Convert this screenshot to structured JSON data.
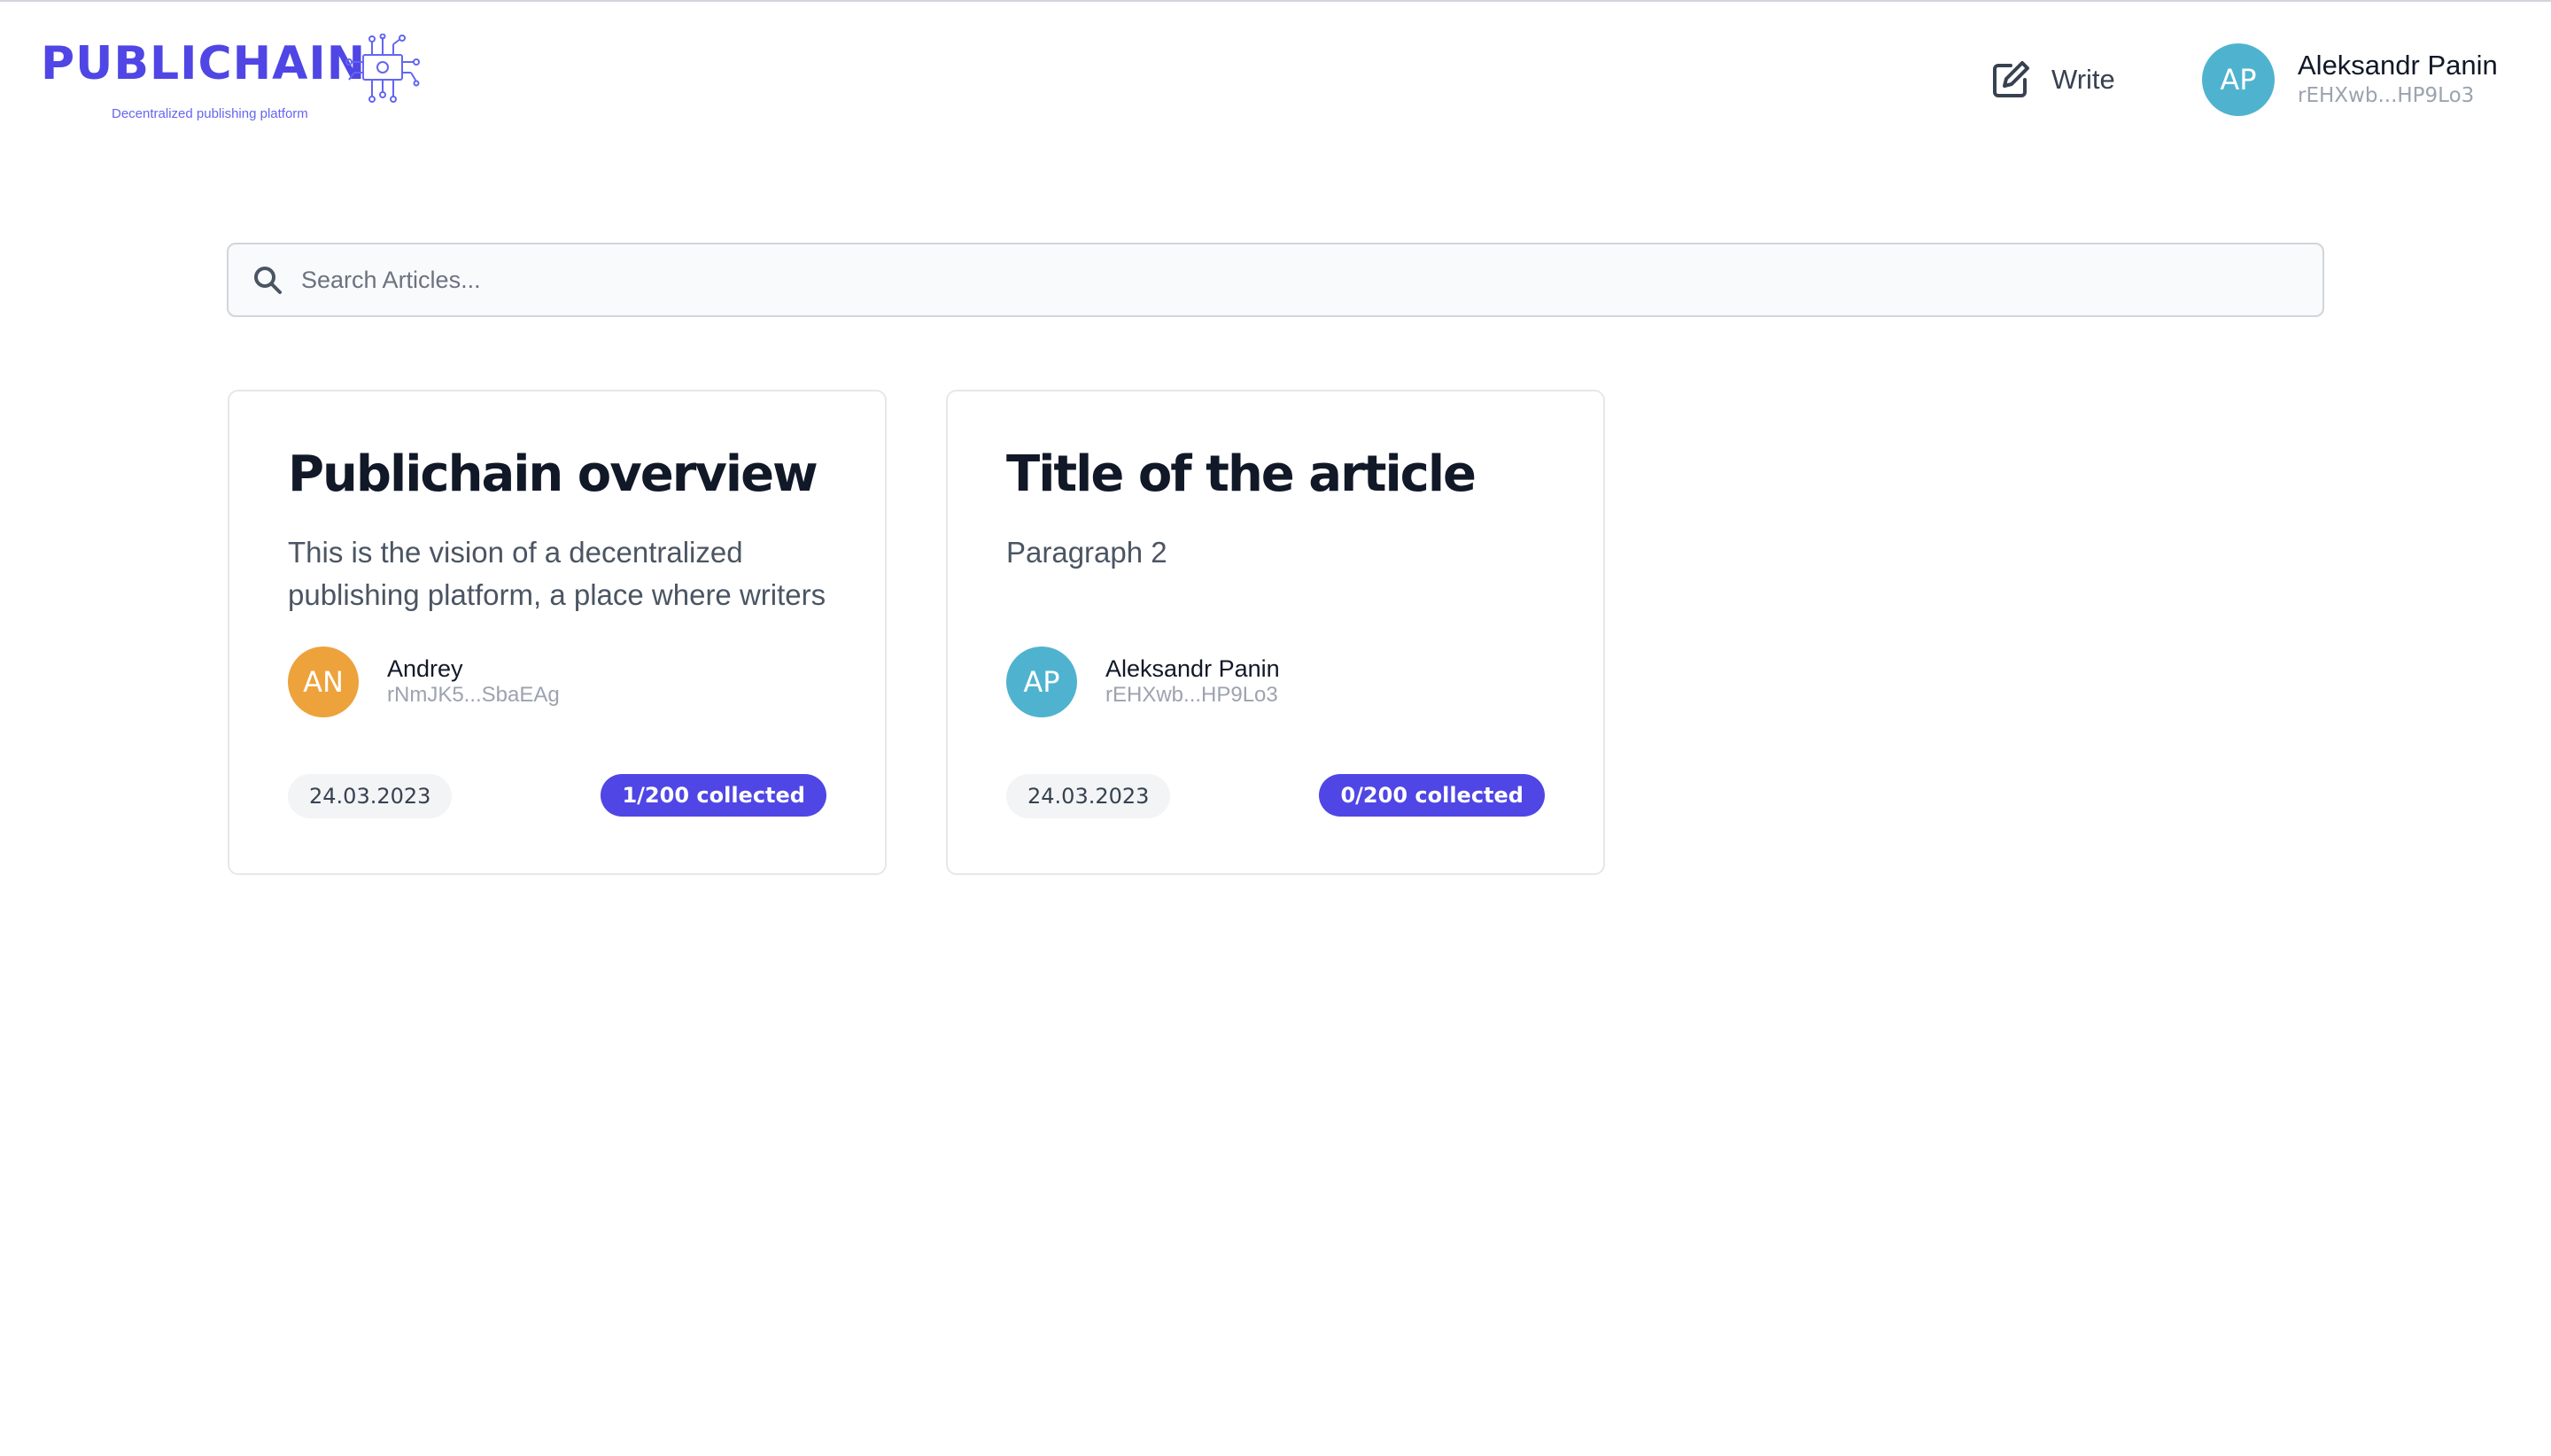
{
  "brand": {
    "name": "PUBLICHAIN",
    "tagline": "Decentralized publishing platform",
    "color": "#4f46e5",
    "logo_icon": "circuit-icon"
  },
  "header": {
    "write_label": "Write",
    "write_icon": "edit-icon",
    "user": {
      "initials": "AP",
      "name": "Aleksandr Panin",
      "address": "rEHXwb...HP9Lo3",
      "avatar_color": "#4fb3cf"
    }
  },
  "search": {
    "placeholder": "Search Articles...",
    "value": "",
    "icon": "search-icon"
  },
  "articles": [
    {
      "title": "Publichain overview",
      "excerpt": "This is the vision of a decentralized publishing platform, a place where writers",
      "author": {
        "initials": "AN",
        "name": "Andrey",
        "address": "rNmJK5...SbaEAg",
        "avatar_color": "#eda23b"
      },
      "date": "24.03.2023",
      "collected": "1/200 collected"
    },
    {
      "title": "Title of the article",
      "excerpt": "Paragraph 2",
      "author": {
        "initials": "AP",
        "name": "Aleksandr Panin",
        "address": "rEHXwb...HP9Lo3",
        "avatar_color": "#4fb3cf"
      },
      "date": "24.03.2023",
      "collected": "0/200 collected"
    }
  ]
}
